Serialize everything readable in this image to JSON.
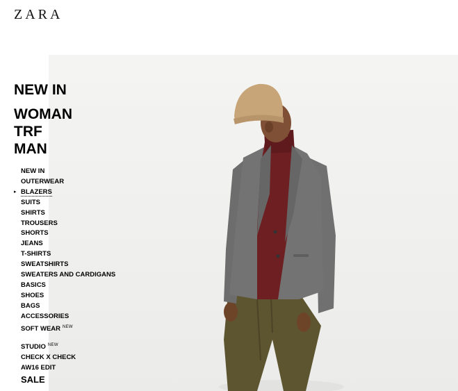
{
  "brand": {
    "logo_text": "ZARA"
  },
  "main_nav": {
    "new_in": "NEW IN",
    "woman": "WOMAN",
    "trf": "TRF",
    "man": "MAN"
  },
  "sub_nav": {
    "active_marker": "▸",
    "items": [
      {
        "label": "NEW IN"
      },
      {
        "label": "OUTERWEAR"
      },
      {
        "label": "BLAZERS"
      },
      {
        "label": "SUITS"
      },
      {
        "label": "SHIRTS"
      },
      {
        "label": "TROUSERS"
      },
      {
        "label": "SHORTS"
      },
      {
        "label": "JEANS"
      },
      {
        "label": "T-SHIRTS"
      },
      {
        "label": "SWEATSHIRTS"
      },
      {
        "label": "SWEATERS AND CARDIGANS"
      },
      {
        "label": "BASICS"
      },
      {
        "label": "SHOES"
      },
      {
        "label": "BAGS"
      },
      {
        "label": "ACCESSORIES"
      },
      {
        "label": "SOFT WEAR",
        "badge": "NEW"
      }
    ],
    "extra_items": [
      {
        "label": "STUDIO",
        "badge": "NEW"
      },
      {
        "label": "CHECK X CHECK"
      },
      {
        "label": "AW16 EDIT"
      }
    ],
    "active_item": "BLAZERS"
  },
  "sale": {
    "label": "SALE"
  },
  "hero": {
    "colors": {
      "background": "#efefed",
      "hat": "#c8a578",
      "blazer": "#6f6f6f",
      "turtleneck": "#6e1f22",
      "trousers": "#5d5530",
      "skin": "#7a4d33"
    }
  }
}
